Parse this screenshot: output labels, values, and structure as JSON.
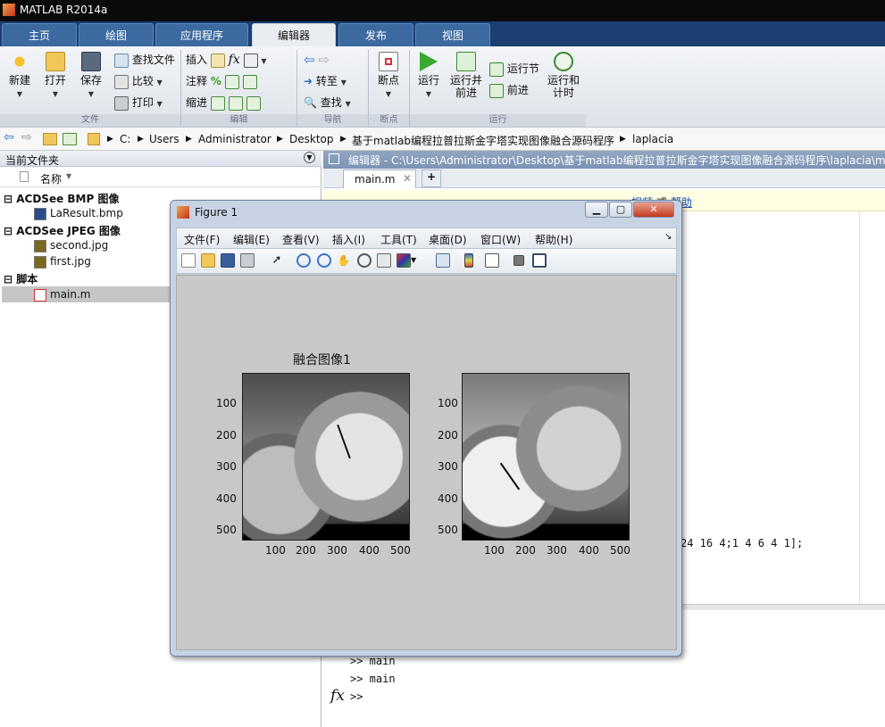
{
  "app": {
    "title": "MATLAB R2014a"
  },
  "tabs": [
    "主页",
    "绘图",
    "应用程序",
    "编辑器",
    "发布",
    "视图"
  ],
  "ribbon": {
    "new": "新建",
    "open": "打开",
    "save": "保存",
    "find_files": "查找文件",
    "compare": "比较",
    "print": "打印",
    "insert": "插入",
    "comment": "注释",
    "indent": "缩进",
    "goto": "转至",
    "find": "查找",
    "breakpoints": "断点",
    "run": "运行",
    "run_advance_1": "运行并",
    "run_advance_2": "前进",
    "run_section": "运行节",
    "advance": "前进",
    "run_time_1": "运行和",
    "run_time_2": "计时",
    "groups": {
      "file": "文件",
      "edit": "编辑",
      "navigate": "导航",
      "breakpoints": "断点",
      "run": "运行"
    },
    "fx": "fx"
  },
  "address": {
    "path": [
      "C:",
      "Users",
      "Administrator",
      "Desktop",
      "基于matlab编程拉普拉斯金字塔实现图像融合源码程序",
      "laplacia"
    ]
  },
  "current_folder": {
    "header": "当前文件夹",
    "name_col": "名称",
    "groups": [
      {
        "label": "ACDSee BMP 图像",
        "items": [
          "LaResult.bmp"
        ]
      },
      {
        "label": "ACDSee JPEG 图像",
        "items": [
          "second.jpg",
          "first.jpg"
        ]
      },
      {
        "label": "脚本",
        "items": [
          "main.m"
        ]
      }
    ]
  },
  "editor": {
    "header": "编辑器 - C:\\Users\\Administrator\\Desktop\\基于matlab编程拉普拉斯金字塔实现图像融合源码程序\\laplacia\\ma",
    "tab": "main.m",
    "add_tab": "+",
    "code_fragment": "24 16 4;1 4 6 4 1];",
    "note_link1": "视频",
    "note_link2": "帮助"
  },
  "command_window": {
    "lines": [
      ">> main",
      ">> main"
    ],
    "prompt": ">>",
    "fx": "fx"
  },
  "figure": {
    "title": "Figure 1",
    "menu": [
      "文件(F)",
      "编辑(E)",
      "查看(V)",
      "插入(I)",
      "工具(T)",
      "桌面(D)",
      "窗口(W)",
      "帮助(H)"
    ],
    "plot_title": "融合图像1",
    "yticks": [
      "100",
      "200",
      "300",
      "400",
      "500"
    ],
    "xticks": [
      "100",
      "200",
      "300",
      "400",
      "500"
    ]
  }
}
